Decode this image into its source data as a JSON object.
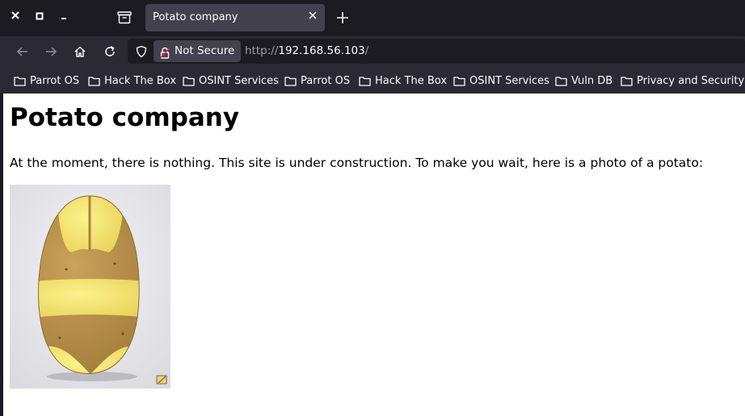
{
  "window_controls": [
    "close-icon",
    "maximize-icon",
    "minimize-icon"
  ],
  "tab": {
    "title": "Potato company",
    "close_icon": "close-icon"
  },
  "new_tab_icon": "plus-icon",
  "nav": {
    "back_icon": "arrow-left-icon",
    "forward_icon": "arrow-right-icon",
    "home_icon": "home-icon",
    "reload_icon": "reload-icon"
  },
  "urlbar": {
    "security_label": "Not Secure",
    "url_scheme": "http://",
    "url_host": "192.168.56.103",
    "url_path": "/"
  },
  "bookmarks": [
    {
      "label": "Parrot OS"
    },
    {
      "label": "Hack The Box"
    },
    {
      "label": "OSINT Services"
    },
    {
      "label": "Parrot OS"
    },
    {
      "label": "Hack The Box"
    },
    {
      "label": "OSINT Services"
    },
    {
      "label": "Vuln DB"
    },
    {
      "label": "Privacy and Security"
    }
  ],
  "page": {
    "heading": "Potato company",
    "text": "At the moment, there is nothing. This site is under construction. To make you wait, here is a photo of a potato:",
    "image": "potato-photo"
  },
  "colors": {
    "tabbar_bg": "#1c1b22",
    "toolbar_bg": "#2b2a33",
    "active_tab_bg": "#42414d",
    "toolbar_text": "#fbfbfe",
    "url_dim_text": "#9f9ea6",
    "page_bg": "#ffffff"
  }
}
